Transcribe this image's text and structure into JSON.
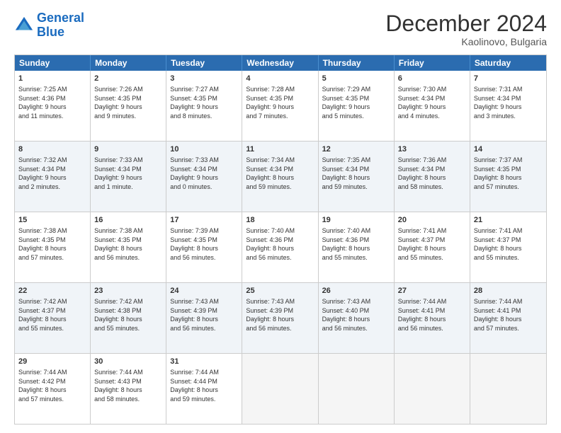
{
  "logo": {
    "line1": "General",
    "line2": "Blue"
  },
  "title": "December 2024",
  "subtitle": "Kaolinovo, Bulgaria",
  "days": [
    "Sunday",
    "Monday",
    "Tuesday",
    "Wednesday",
    "Thursday",
    "Friday",
    "Saturday"
  ],
  "weeks": [
    [
      {
        "day": "1",
        "lines": [
          "Sunrise: 7:25 AM",
          "Sunset: 4:36 PM",
          "Daylight: 9 hours",
          "and 11 minutes."
        ]
      },
      {
        "day": "2",
        "lines": [
          "Sunrise: 7:26 AM",
          "Sunset: 4:35 PM",
          "Daylight: 9 hours",
          "and 9 minutes."
        ]
      },
      {
        "day": "3",
        "lines": [
          "Sunrise: 7:27 AM",
          "Sunset: 4:35 PM",
          "Daylight: 9 hours",
          "and 8 minutes."
        ]
      },
      {
        "day": "4",
        "lines": [
          "Sunrise: 7:28 AM",
          "Sunset: 4:35 PM",
          "Daylight: 9 hours",
          "and 7 minutes."
        ]
      },
      {
        "day": "5",
        "lines": [
          "Sunrise: 7:29 AM",
          "Sunset: 4:35 PM",
          "Daylight: 9 hours",
          "and 5 minutes."
        ]
      },
      {
        "day": "6",
        "lines": [
          "Sunrise: 7:30 AM",
          "Sunset: 4:34 PM",
          "Daylight: 9 hours",
          "and 4 minutes."
        ]
      },
      {
        "day": "7",
        "lines": [
          "Sunrise: 7:31 AM",
          "Sunset: 4:34 PM",
          "Daylight: 9 hours",
          "and 3 minutes."
        ]
      }
    ],
    [
      {
        "day": "8",
        "lines": [
          "Sunrise: 7:32 AM",
          "Sunset: 4:34 PM",
          "Daylight: 9 hours",
          "and 2 minutes."
        ]
      },
      {
        "day": "9",
        "lines": [
          "Sunrise: 7:33 AM",
          "Sunset: 4:34 PM",
          "Daylight: 9 hours",
          "and 1 minute."
        ]
      },
      {
        "day": "10",
        "lines": [
          "Sunrise: 7:33 AM",
          "Sunset: 4:34 PM",
          "Daylight: 9 hours",
          "and 0 minutes."
        ]
      },
      {
        "day": "11",
        "lines": [
          "Sunrise: 7:34 AM",
          "Sunset: 4:34 PM",
          "Daylight: 8 hours",
          "and 59 minutes."
        ]
      },
      {
        "day": "12",
        "lines": [
          "Sunrise: 7:35 AM",
          "Sunset: 4:34 PM",
          "Daylight: 8 hours",
          "and 59 minutes."
        ]
      },
      {
        "day": "13",
        "lines": [
          "Sunrise: 7:36 AM",
          "Sunset: 4:34 PM",
          "Daylight: 8 hours",
          "and 58 minutes."
        ]
      },
      {
        "day": "14",
        "lines": [
          "Sunrise: 7:37 AM",
          "Sunset: 4:35 PM",
          "Daylight: 8 hours",
          "and 57 minutes."
        ]
      }
    ],
    [
      {
        "day": "15",
        "lines": [
          "Sunrise: 7:38 AM",
          "Sunset: 4:35 PM",
          "Daylight: 8 hours",
          "and 57 minutes."
        ]
      },
      {
        "day": "16",
        "lines": [
          "Sunrise: 7:38 AM",
          "Sunset: 4:35 PM",
          "Daylight: 8 hours",
          "and 56 minutes."
        ]
      },
      {
        "day": "17",
        "lines": [
          "Sunrise: 7:39 AM",
          "Sunset: 4:35 PM",
          "Daylight: 8 hours",
          "and 56 minutes."
        ]
      },
      {
        "day": "18",
        "lines": [
          "Sunrise: 7:40 AM",
          "Sunset: 4:36 PM",
          "Daylight: 8 hours",
          "and 56 minutes."
        ]
      },
      {
        "day": "19",
        "lines": [
          "Sunrise: 7:40 AM",
          "Sunset: 4:36 PM",
          "Daylight: 8 hours",
          "and 55 minutes."
        ]
      },
      {
        "day": "20",
        "lines": [
          "Sunrise: 7:41 AM",
          "Sunset: 4:37 PM",
          "Daylight: 8 hours",
          "and 55 minutes."
        ]
      },
      {
        "day": "21",
        "lines": [
          "Sunrise: 7:41 AM",
          "Sunset: 4:37 PM",
          "Daylight: 8 hours",
          "and 55 minutes."
        ]
      }
    ],
    [
      {
        "day": "22",
        "lines": [
          "Sunrise: 7:42 AM",
          "Sunset: 4:37 PM",
          "Daylight: 8 hours",
          "and 55 minutes."
        ]
      },
      {
        "day": "23",
        "lines": [
          "Sunrise: 7:42 AM",
          "Sunset: 4:38 PM",
          "Daylight: 8 hours",
          "and 55 minutes."
        ]
      },
      {
        "day": "24",
        "lines": [
          "Sunrise: 7:43 AM",
          "Sunset: 4:39 PM",
          "Daylight: 8 hours",
          "and 56 minutes."
        ]
      },
      {
        "day": "25",
        "lines": [
          "Sunrise: 7:43 AM",
          "Sunset: 4:39 PM",
          "Daylight: 8 hours",
          "and 56 minutes."
        ]
      },
      {
        "day": "26",
        "lines": [
          "Sunrise: 7:43 AM",
          "Sunset: 4:40 PM",
          "Daylight: 8 hours",
          "and 56 minutes."
        ]
      },
      {
        "day": "27",
        "lines": [
          "Sunrise: 7:44 AM",
          "Sunset: 4:41 PM",
          "Daylight: 8 hours",
          "and 56 minutes."
        ]
      },
      {
        "day": "28",
        "lines": [
          "Sunrise: 7:44 AM",
          "Sunset: 4:41 PM",
          "Daylight: 8 hours",
          "and 57 minutes."
        ]
      }
    ],
    [
      {
        "day": "29",
        "lines": [
          "Sunrise: 7:44 AM",
          "Sunset: 4:42 PM",
          "Daylight: 8 hours",
          "and 57 minutes."
        ]
      },
      {
        "day": "30",
        "lines": [
          "Sunrise: 7:44 AM",
          "Sunset: 4:43 PM",
          "Daylight: 8 hours",
          "and 58 minutes."
        ]
      },
      {
        "day": "31",
        "lines": [
          "Sunrise: 7:44 AM",
          "Sunset: 4:44 PM",
          "Daylight: 8 hours",
          "and 59 minutes."
        ]
      },
      null,
      null,
      null,
      null
    ]
  ]
}
